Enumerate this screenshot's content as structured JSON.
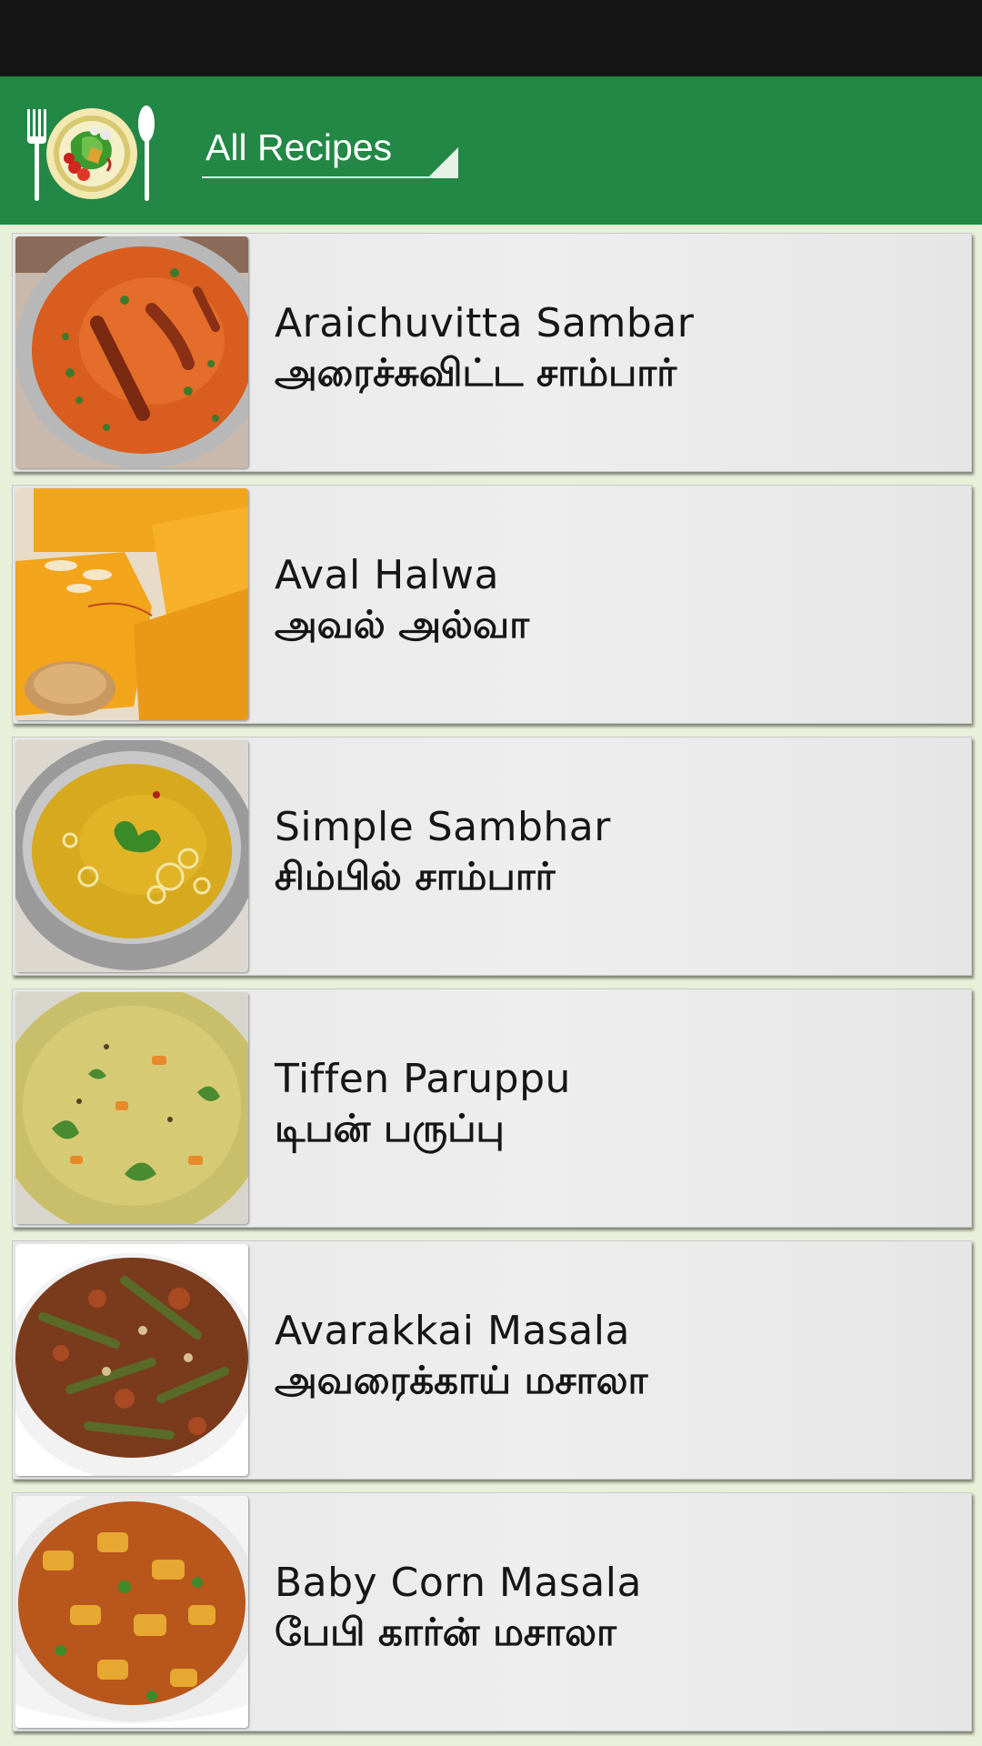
{
  "app_bar": {
    "logo_icon": "food-plate-with-fork-and-spoon-icon",
    "category_selector": {
      "selected": "All Recipes"
    },
    "colors": {
      "status_bar": "#151515",
      "app_bar": "#238745",
      "list_background": "#e8f0d9",
      "card_background": "#eaeaea"
    }
  },
  "recipes": [
    {
      "name_en": "Araichuvitta Sambar",
      "name_ta": "அரைச்சுவிட்ட சாம்பார்",
      "thumb_icon": "sambar-bowl-image"
    },
    {
      "name_en": "Aval Halwa",
      "name_ta": "அவல் அல்வா",
      "thumb_icon": "halwa-pieces-image"
    },
    {
      "name_en": "Simple Sambhar",
      "name_ta": "சிம்பில் சாம்பார்",
      "thumb_icon": "sambhar-pot-image"
    },
    {
      "name_en": "Tiffen Paruppu",
      "name_ta": "டிபன் பருப்பு",
      "thumb_icon": "paruppu-dal-image"
    },
    {
      "name_en": "Avarakkai Masala",
      "name_ta": "அவரைக்காய் மசாலா",
      "thumb_icon": "avarakkai-masala-bowl-image"
    },
    {
      "name_en": "Baby Corn Masala",
      "name_ta": "பேபி கார்ன் மசாலா",
      "thumb_icon": "baby-corn-masala-bowl-image"
    }
  ]
}
